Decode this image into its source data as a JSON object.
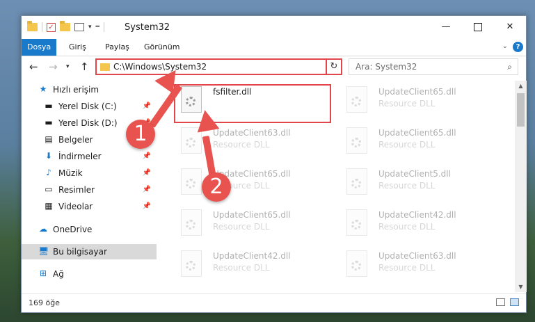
{
  "window": {
    "title": "System32",
    "minimize_glyph": "—",
    "close_glyph": "✕"
  },
  "ribbon": {
    "tabs": [
      "Dosya",
      "Giriş",
      "Paylaş",
      "Görünüm"
    ],
    "help": "?"
  },
  "address": {
    "path": "C:\\Windows\\System32"
  },
  "search": {
    "placeholder": "Ara: System32"
  },
  "sidebar": {
    "items": [
      {
        "label": "Hızlı erişim",
        "icon": "star-icon"
      },
      {
        "label": "Yerel Disk (C:)",
        "icon": "drive-icon",
        "pinned": true
      },
      {
        "label": "Yerel Disk (D:)",
        "icon": "drive-icon",
        "pinned": true
      },
      {
        "label": "Belgeler",
        "icon": "document-icon",
        "pinned": true
      },
      {
        "label": "İndirmeler",
        "icon": "download-icon",
        "pinned": true
      },
      {
        "label": "Müzik",
        "icon": "music-icon",
        "pinned": true
      },
      {
        "label": "Resimler",
        "icon": "pictures-icon",
        "pinned": true
      },
      {
        "label": "Videolar",
        "icon": "video-icon",
        "pinned": true
      },
      {
        "label": "OneDrive",
        "icon": "cloud-icon"
      },
      {
        "label": "Bu bilgisayar",
        "icon": "computer-icon",
        "selected": true
      },
      {
        "label": "Ağ",
        "icon": "network-icon"
      }
    ]
  },
  "files": [
    {
      "name": "fsfilter.dll",
      "type": "",
      "highlighted": true
    },
    {
      "name": "UpdateClient65.dll",
      "type": "Resource DLL"
    },
    {
      "name": "UpdateClient63.dll",
      "type": "Resource DLL"
    },
    {
      "name": "UpdateClient65.dll",
      "type": "Resource DLL"
    },
    {
      "name": "UpdateClient65.dll",
      "type": "Resource DLL"
    },
    {
      "name": "UpdateClient5.dll",
      "type": "Resource DLL"
    },
    {
      "name": "UpdateClient65.dll",
      "type": "Resource DLL"
    },
    {
      "name": "UpdateClient42.dll",
      "type": "Resource DLL"
    },
    {
      "name": "UpdateClient42.dll",
      "type": "Resource DLL"
    },
    {
      "name": "UpdateClient63.dll",
      "type": "Resource DLL"
    }
  ],
  "status": {
    "count": "169 öğe"
  },
  "annotations": {
    "step1": "1",
    "step2": "2",
    "color": "#e8524f"
  }
}
